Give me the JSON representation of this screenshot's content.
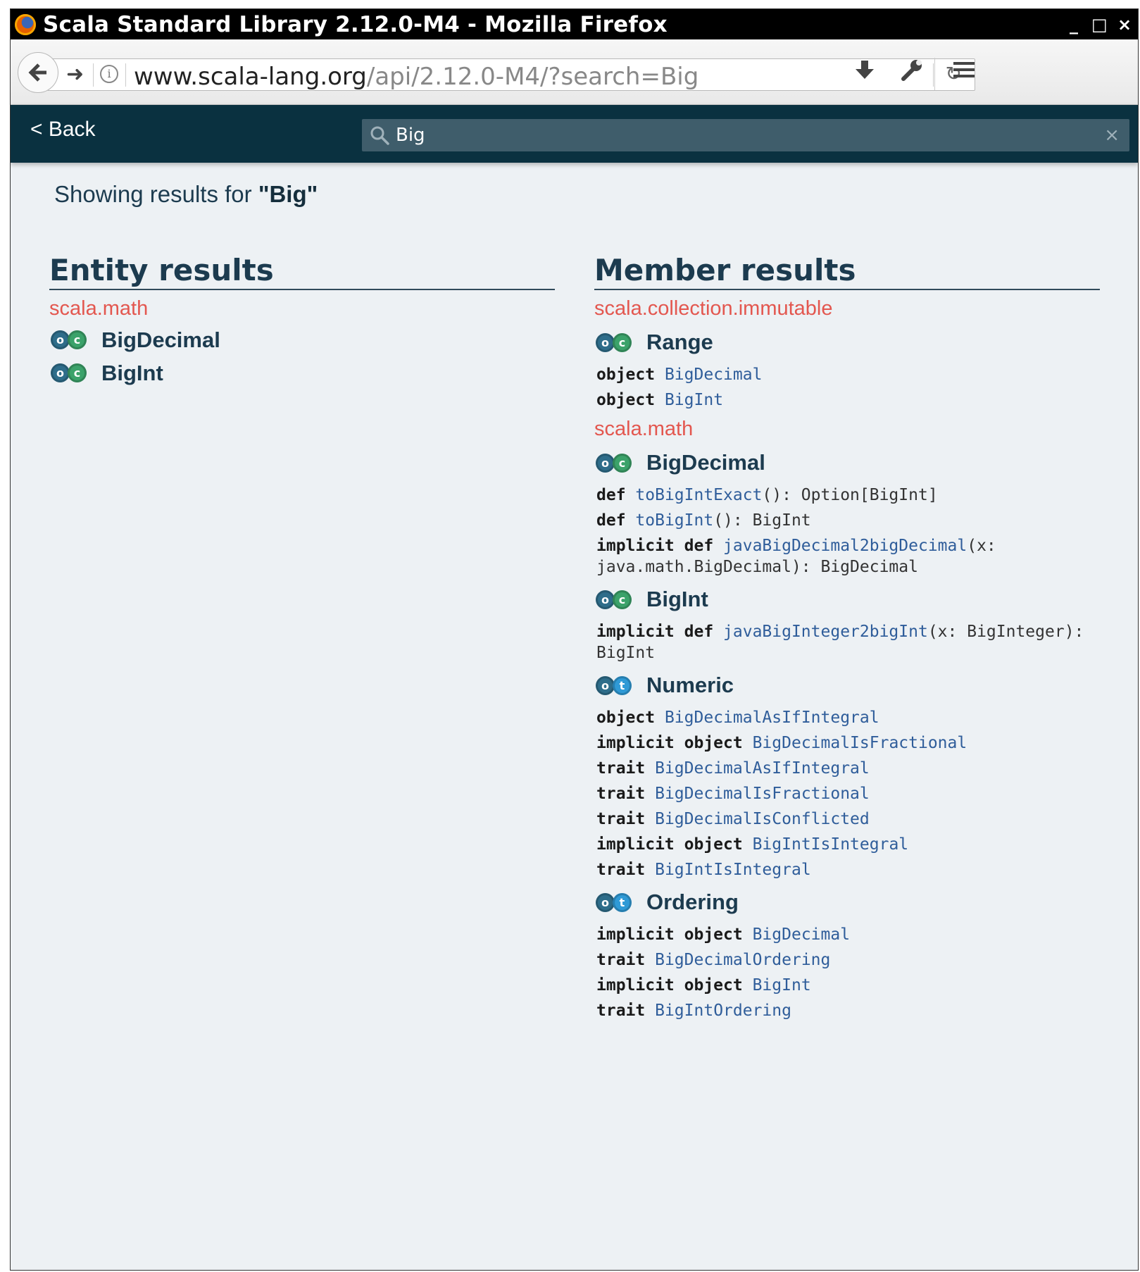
{
  "window": {
    "title": "Scala Standard Library 2.12.0-M4 - Mozilla Firefox",
    "controls": [
      "_",
      "□",
      "×"
    ]
  },
  "toolbar": {
    "back_icon": "arrow-left-icon",
    "forward_icon": "arrow-right-icon",
    "url_domain": "www.scala-lang.org",
    "url_path": "/api/2.12.0-M4/?search=Big",
    "icons": [
      "download-icon",
      "wrench-icon",
      "hamburger-menu-icon"
    ]
  },
  "header": {
    "back_label": "< Back",
    "search_value": "Big",
    "clear_label": "×"
  },
  "results": {
    "prefix": "Showing results for ",
    "query": "\"Big\""
  },
  "entity_results": {
    "title": "Entity results",
    "package": "scala.math",
    "items": [
      {
        "badges": [
          "o",
          "c"
        ],
        "name": "BigDecimal"
      },
      {
        "badges": [
          "o",
          "c"
        ],
        "name": "BigInt"
      }
    ]
  },
  "member_results": {
    "title": "Member results",
    "groups": [
      {
        "package": "scala.collection.immutable",
        "entities": [
          {
            "badges": [
              "o",
              "c"
            ],
            "name": "Range",
            "members": [
              {
                "kw": "object",
                "name": "BigDecimal",
                "sig": ""
              },
              {
                "kw": "object",
                "name": "BigInt",
                "sig": ""
              }
            ]
          }
        ]
      },
      {
        "package": "scala.math",
        "entities": [
          {
            "badges": [
              "o",
              "c"
            ],
            "name": "BigDecimal",
            "members": [
              {
                "kw": "def",
                "name": "toBigIntExact",
                "sig": "(): Option[BigInt]"
              },
              {
                "kw": "def",
                "name": "toBigInt",
                "sig": "(): BigInt"
              },
              {
                "kw": "implicit def",
                "name": "javaBigDecimal2bigDecimal",
                "sig": "(x: java.math.BigDecimal): BigDecimal"
              }
            ]
          },
          {
            "badges": [
              "o",
              "c"
            ],
            "name": "BigInt",
            "members": [
              {
                "kw": "implicit def",
                "name": "javaBigInteger2bigInt",
                "sig": "(x: BigInteger): BigInt"
              }
            ]
          },
          {
            "badges": [
              "o",
              "t"
            ],
            "name": "Numeric",
            "members": [
              {
                "kw": "object",
                "name": "BigDecimalAsIfIntegral",
                "sig": ""
              },
              {
                "kw": "implicit object",
                "name": "BigDecimalIsFractional",
                "sig": ""
              },
              {
                "kw": "trait",
                "name": "BigDecimalAsIfIntegral",
                "sig": ""
              },
              {
                "kw": "trait",
                "name": "BigDecimalIsFractional",
                "sig": ""
              },
              {
                "kw": "trait",
                "name": "BigDecimalIsConflicted",
                "sig": ""
              },
              {
                "kw": "implicit object",
                "name": "BigIntIsIntegral",
                "sig": ""
              },
              {
                "kw": "trait",
                "name": "BigIntIsIntegral",
                "sig": ""
              }
            ]
          },
          {
            "badges": [
              "o",
              "t"
            ],
            "name": "Ordering",
            "members": [
              {
                "kw": "implicit object",
                "name": "BigDecimal",
                "sig": ""
              },
              {
                "kw": "trait",
                "name": "BigDecimalOrdering",
                "sig": ""
              },
              {
                "kw": "implicit object",
                "name": "BigInt",
                "sig": ""
              },
              {
                "kw": "trait",
                "name": "BigIntOrdering",
                "sig": ""
              }
            ]
          }
        ]
      }
    ]
  },
  "colors": {
    "header_bg": "#0a3140",
    "page_bg": "#edf1f4",
    "package_text": "#e3574f",
    "object_badge": "#2e6d8a",
    "class_badge": "#3ba26a",
    "trait_badge": "#2f9ad6"
  }
}
